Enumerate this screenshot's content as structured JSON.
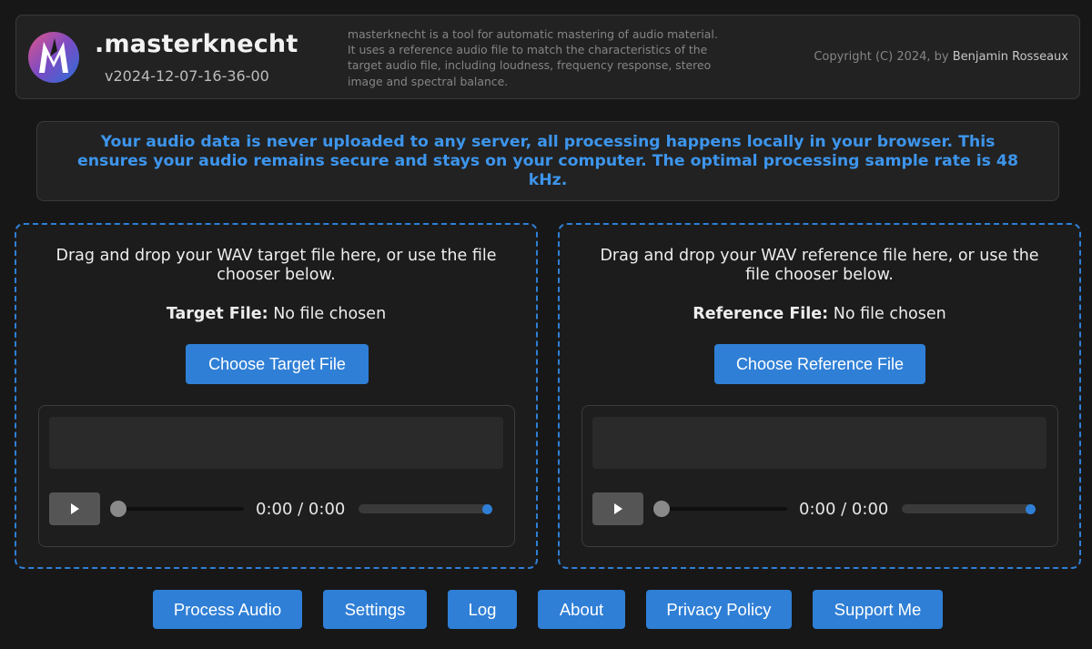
{
  "header": {
    "title": ".masterknecht",
    "version": "v2024-12-07-16-36-00",
    "description": "masterknecht is a tool for automatic mastering of audio material. It uses a reference audio file to match the characteristics of the target audio file, including loudness, frequency response, stereo image and spectral balance.",
    "copyright_prefix": "Copyright (C) 2024, by ",
    "copyright_author": "Benjamin Rosseaux"
  },
  "notice": "Your audio data is never uploaded to any server, all processing happens locally in your browser. This ensures your audio remains secure and stays on your computer. The optimal processing sample rate is 48 kHz.",
  "target": {
    "instructions": "Drag and drop your WAV target file here, or use the file chooser below.",
    "file_label": "Target File:",
    "file_value": "No file chosen",
    "button_label": "Choose Target File",
    "player": {
      "time": "0:00 / 0:00",
      "play_icon": "play-icon",
      "volume": 1.0
    }
  },
  "reference": {
    "instructions": "Drag and drop your WAV reference file here, or use the file chooser below.",
    "file_label": "Reference File:",
    "file_value": "No file chosen",
    "button_label": "Choose Reference File",
    "player": {
      "time": "0:00 / 0:00",
      "play_icon": "play-icon",
      "volume": 1.0
    }
  },
  "actions": {
    "process": "Process Audio",
    "settings": "Settings",
    "log": "Log",
    "about": "About",
    "privacy": "Privacy Policy",
    "support": "Support Me"
  },
  "colors": {
    "accent": "#2f7fd6",
    "notice_text": "#3d95ec",
    "background": "#171717",
    "panel": "#222222"
  }
}
